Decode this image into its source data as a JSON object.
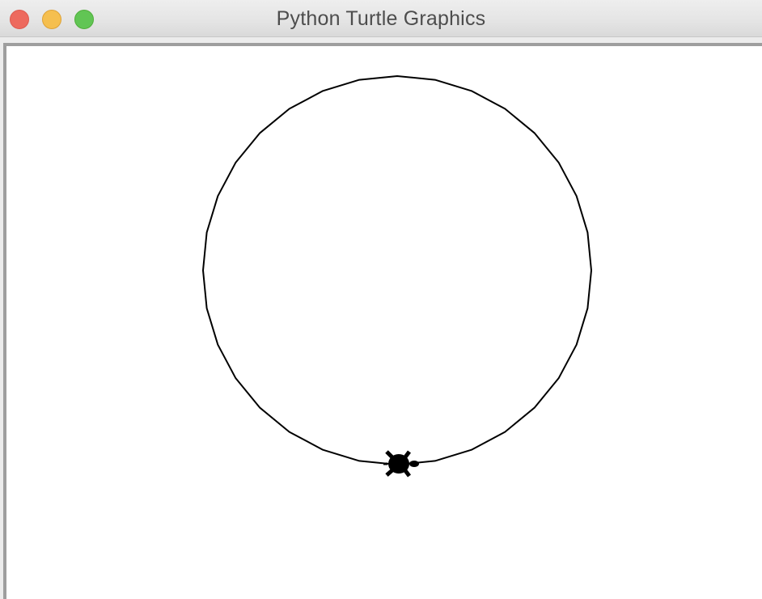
{
  "window": {
    "title": "Python Turtle Graphics",
    "buttons": {
      "close": {
        "label": "close",
        "color": "#ed6a5e"
      },
      "minimize": {
        "label": "minimize",
        "color": "#f5bf4f"
      },
      "zoom": {
        "label": "zoom",
        "color": "#61c554"
      }
    }
  },
  "canvas": {
    "background": "#ffffff",
    "border_color": "#9e9e9e",
    "drawing": {
      "shape": "circle-polygon",
      "segments": 32,
      "line_color": "#000000"
    },
    "turtle": {
      "shape": "turtle",
      "color": "#000000",
      "heading": "east"
    }
  }
}
